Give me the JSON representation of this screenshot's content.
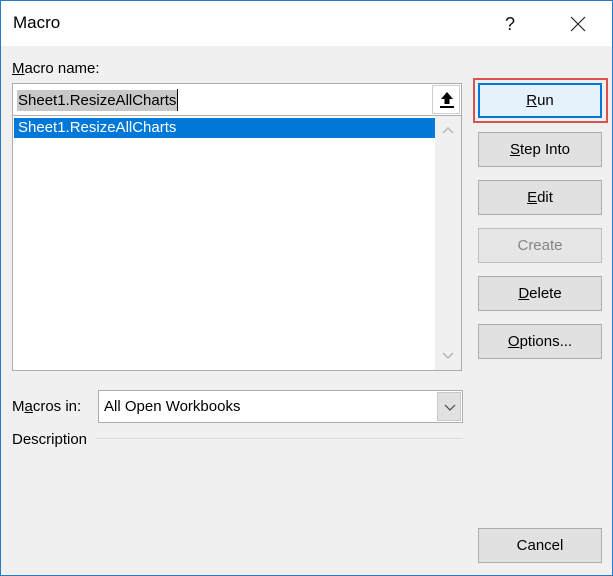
{
  "window": {
    "title": "Macro",
    "help_label": "?",
    "close_icon": "close-icon"
  },
  "macro_name": {
    "label_accel": "M",
    "label_rest": "acro name:",
    "value": "Sheet1.ResizeAllCharts",
    "upload_icon": "arrow-up-icon"
  },
  "macro_list": {
    "items": [
      "Sheet1.ResizeAllCharts"
    ],
    "selected_index": 0
  },
  "buttons": {
    "run": {
      "accel": "R",
      "rest": "un"
    },
    "step_into": {
      "accel": "S",
      "rest": "tep Into"
    },
    "edit": {
      "accel": "E",
      "rest": "dit"
    },
    "create": {
      "label": "Create",
      "disabled": true
    },
    "delete": {
      "accel": "D",
      "rest": "elete"
    },
    "options": {
      "accel": "O",
      "rest": "ptions..."
    },
    "cancel": {
      "label": "Cancel"
    }
  },
  "macros_in": {
    "label_pre": "M",
    "label_accel": "a",
    "label_rest": "cros in:",
    "selected": "All Open Workbooks"
  },
  "description": {
    "label": "Description"
  },
  "colors": {
    "selection": "#0078d7",
    "highlight_frame": "#d9534f",
    "window_border": "#2b79c2"
  }
}
